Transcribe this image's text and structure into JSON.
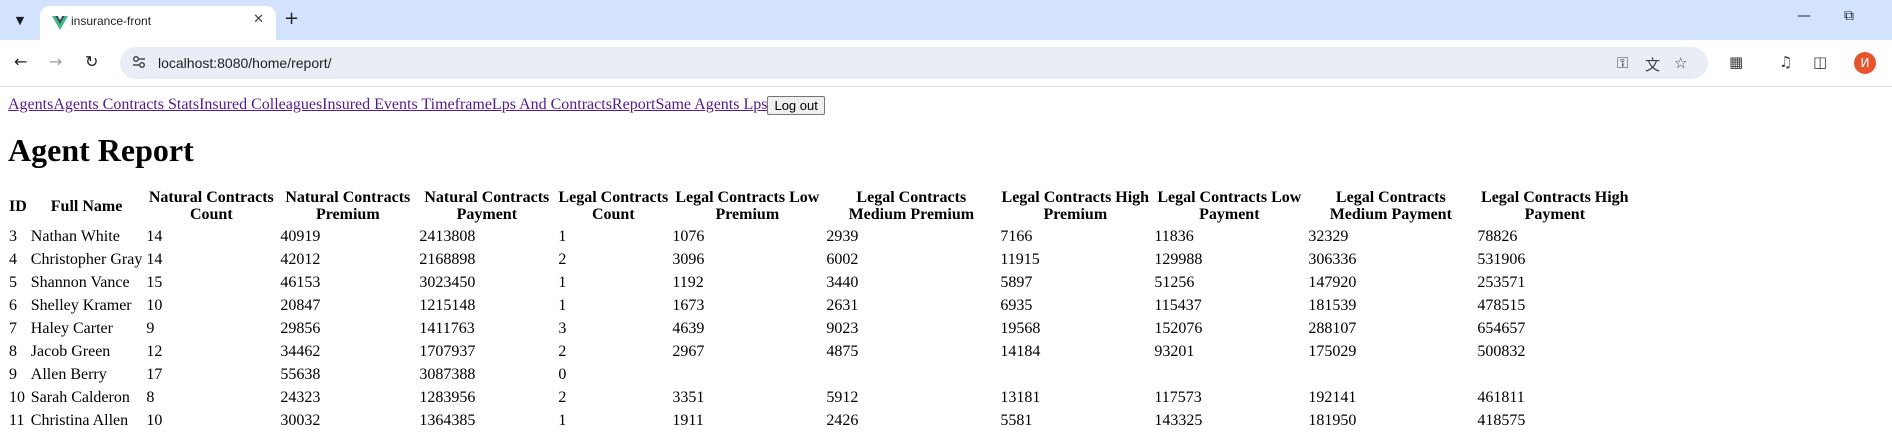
{
  "browser": {
    "tab_title": "insurance-front",
    "url": "localhost:8080/home/report/",
    "profile_initial": "И",
    "icons": {
      "tab_search": "chevron-down-icon",
      "favicon": "vue-logo-icon",
      "close_tab": "close-icon",
      "new_tab": "plus-icon",
      "back": "arrow-left-icon",
      "forward": "arrow-right-icon",
      "reload": "reload-icon",
      "site_info": "site-info-icon",
      "password": "key-icon",
      "translate": "translate-icon",
      "bookmark": "star-icon",
      "extensions": "puzzle-icon",
      "media": "media-control-icon",
      "side_panel": "side-panel-icon",
      "minimize": "minimize-icon",
      "restore": "restore-icon"
    },
    "colors": {
      "tabstrip": "#d3e3fd",
      "omnibox": "#e9eef6",
      "avatar": "#e8542e",
      "link": "#551a8b"
    }
  },
  "nav": {
    "links": [
      "Agents",
      "Agents Contracts Stats",
      "Insured Colleagues",
      "Insured Events Timeframe",
      "Lps And Contracts",
      "Report",
      "Same Agents Lps"
    ],
    "logout_label": "Log out"
  },
  "page_title": "Agent Report",
  "table": {
    "headers": [
      "ID",
      "Full Name",
      "Natural Contracts Count",
      "Natural Contracts Premium",
      "Natural Contracts Payment",
      "Legal Contracts Count",
      "Legal Contracts Low Premium",
      "Legal Contracts Medium Premium",
      "Legal Contracts High Premium",
      "Legal Contracts Low Payment",
      "Legal Contracts Medium Payment",
      "Legal Contracts High Payment"
    ],
    "rows": [
      [
        "3",
        "Nathan White",
        "14",
        "40919",
        "2413808",
        "1",
        "1076",
        "2939",
        "7166",
        "11836",
        "32329",
        "78826"
      ],
      [
        "4",
        "Christopher Gray",
        "14",
        "42012",
        "2168898",
        "2",
        "3096",
        "6002",
        "11915",
        "129988",
        "306336",
        "531906"
      ],
      [
        "5",
        "Shannon Vance",
        "15",
        "46153",
        "3023450",
        "1",
        "1192",
        "3440",
        "5897",
        "51256",
        "147920",
        "253571"
      ],
      [
        "6",
        "Shelley Kramer",
        "10",
        "20847",
        "1215148",
        "1",
        "1673",
        "2631",
        "6935",
        "115437",
        "181539",
        "478515"
      ],
      [
        "7",
        "Haley Carter",
        "9",
        "29856",
        "1411763",
        "3",
        "4639",
        "9023",
        "19568",
        "152076",
        "288107",
        "654657"
      ],
      [
        "8",
        "Jacob Green",
        "12",
        "34462",
        "1707937",
        "2",
        "2967",
        "4875",
        "14184",
        "93201",
        "175029",
        "500832"
      ],
      [
        "9",
        "Allen Berry",
        "17",
        "55638",
        "3087388",
        "0",
        "",
        "",
        "",
        "",
        "",
        ""
      ],
      [
        "10",
        "Sarah Calderon",
        "8",
        "24323",
        "1283956",
        "2",
        "3351",
        "5912",
        "13181",
        "117573",
        "192141",
        "461811"
      ],
      [
        "11",
        "Christina Allen",
        "10",
        "30032",
        "1364385",
        "1",
        "1911",
        "2426",
        "5581",
        "143325",
        "181950",
        "418575"
      ]
    ]
  }
}
